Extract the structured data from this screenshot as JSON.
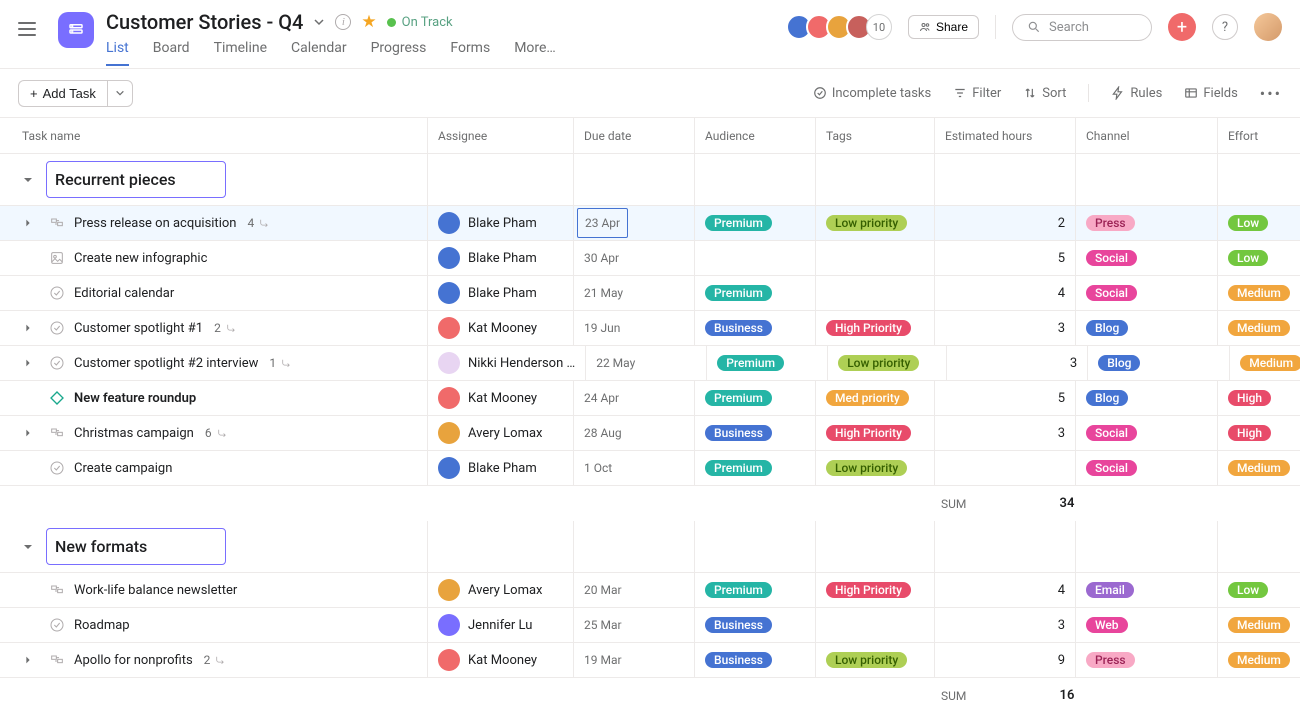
{
  "header": {
    "title": "Customer Stories - Q4",
    "status": "On Track",
    "tabs": [
      "List",
      "Board",
      "Timeline",
      "Calendar",
      "Progress",
      "Forms",
      "More…"
    ],
    "active_tab": 0,
    "avatar_count": "10",
    "share": "Share",
    "search_placeholder": "Search",
    "avatars": [
      {
        "bg": "#4573d2"
      },
      {
        "bg": "#f06a6a"
      },
      {
        "bg": "#e8a33d"
      },
      {
        "bg": "#c7605c"
      }
    ]
  },
  "toolbar": {
    "add_task": "Add Task",
    "incomplete": "Incomplete tasks",
    "filter": "Filter",
    "sort": "Sort",
    "rules": "Rules",
    "fields": "Fields"
  },
  "columns": {
    "task": "Task name",
    "assignee": "Assignee",
    "due": "Due date",
    "audience": "Audience",
    "tags": "Tags",
    "est": "Estimated hours",
    "channel": "Channel",
    "effort": "Effort"
  },
  "sections": [
    {
      "name": "Recurrent pieces",
      "rows": [
        {
          "expand": true,
          "icon": "milestone",
          "name": "Press release on acquisition",
          "subs": 4,
          "sub_icon": true,
          "assignee": "Blake Pham",
          "avatar": "bp",
          "due": "23 Apr",
          "due_box": true,
          "audience": {
            "t": "Premium",
            "c": "#25b5a6"
          },
          "tags": {
            "t": "Low priority",
            "c": "#aecf55",
            "tc": "#355f00"
          },
          "est": 2,
          "channel": {
            "t": "Press",
            "c": "#f8a9c5",
            "tc": "#9b2255"
          },
          "effort": {
            "t": "Low",
            "c": "#73c73f"
          },
          "hl": true
        },
        {
          "expand": false,
          "icon": "picture",
          "name": "Create new infographic",
          "assignee": "Blake Pham",
          "avatar": "bp",
          "due": "30 Apr",
          "est": 5,
          "channel": {
            "t": "Social",
            "c": "#e8459c"
          },
          "effort": {
            "t": "Low",
            "c": "#73c73f"
          }
        },
        {
          "expand": false,
          "icon": "circle",
          "name": "Editorial calendar",
          "assignee": "Blake Pham",
          "avatar": "bp",
          "due": "21 May",
          "audience": {
            "t": "Premium",
            "c": "#25b5a6"
          },
          "est": 4,
          "channel": {
            "t": "Social",
            "c": "#e8459c"
          },
          "effort": {
            "t": "Medium",
            "c": "#f1a63e"
          }
        },
        {
          "expand": true,
          "icon": "circle",
          "name": "Customer spotlight #1",
          "subs": 2,
          "sub_icon": true,
          "assignee": "Kat Mooney",
          "avatar": "km",
          "due": "19 Jun",
          "audience": {
            "t": "Business",
            "c": "#4573d2"
          },
          "tags": {
            "t": "High Priority",
            "c": "#e84b6a"
          },
          "est": 3,
          "channel": {
            "t": "Blog",
            "c": "#4573d2"
          },
          "effort": {
            "t": "Medium",
            "c": "#f1a63e"
          }
        },
        {
          "expand": true,
          "icon": "circle",
          "name": "Customer spotlight #2 interview",
          "subs": 1,
          "sub_icon": true,
          "assignee": "Nikki Henderson …",
          "avatar": "nh",
          "due": "22 May",
          "audience": {
            "t": "Premium",
            "c": "#25b5a6"
          },
          "tags": {
            "t": "Low priority",
            "c": "#aecf55",
            "tc": "#355f00"
          },
          "est": 3,
          "channel": {
            "t": "Blog",
            "c": "#4573d2"
          },
          "effort": {
            "t": "Medium",
            "c": "#f1a63e"
          }
        },
        {
          "expand": false,
          "icon": "diamond",
          "name": "New feature roundup",
          "bold": true,
          "assignee": "Kat Mooney",
          "avatar": "km",
          "due": "24 Apr",
          "audience": {
            "t": "Premium",
            "c": "#25b5a6"
          },
          "tags": {
            "t": "Med priority",
            "c": "#f1a63e"
          },
          "est": 5,
          "channel": {
            "t": "Blog",
            "c": "#4573d2"
          },
          "effort": {
            "t": "High",
            "c": "#e84b6a"
          }
        },
        {
          "expand": true,
          "icon": "milestone",
          "name": "Christmas campaign",
          "subs": 6,
          "sub_icon": true,
          "assignee": "Avery Lomax",
          "avatar": "al",
          "due": "28 Aug",
          "audience": {
            "t": "Business",
            "c": "#4573d2"
          },
          "tags": {
            "t": "High Priority",
            "c": "#e84b6a"
          },
          "est": 3,
          "channel": {
            "t": "Social",
            "c": "#e8459c"
          },
          "effort": {
            "t": "High",
            "c": "#e84b6a"
          }
        },
        {
          "expand": false,
          "icon": "circle",
          "name": "Create campaign",
          "assignee": "Blake Pham",
          "avatar": "bp",
          "due": "1 Oct",
          "audience": {
            "t": "Premium",
            "c": "#25b5a6"
          },
          "tags": {
            "t": "Low priority",
            "c": "#aecf55",
            "tc": "#355f00"
          },
          "channel": {
            "t": "Social",
            "c": "#e8459c"
          },
          "effort": {
            "t": "Medium",
            "c": "#f1a63e"
          }
        }
      ],
      "sum_label": "SUM",
      "sum": 34
    },
    {
      "name": "New formats",
      "rows": [
        {
          "expand": false,
          "icon": "milestone",
          "name": "Work-life balance newsletter",
          "assignee": "Avery Lomax",
          "avatar": "al",
          "due": "20 Mar",
          "audience": {
            "t": "Premium",
            "c": "#25b5a6"
          },
          "tags": {
            "t": "High Priority",
            "c": "#e84b6a"
          },
          "est": 4,
          "channel": {
            "t": "Email",
            "c": "#9b69d0"
          },
          "effort": {
            "t": "Low",
            "c": "#73c73f"
          }
        },
        {
          "expand": false,
          "icon": "circle",
          "name": "Roadmap",
          "assignee": "Jennifer Lu",
          "avatar": "jl",
          "due": "25 Mar",
          "audience": {
            "t": "Business",
            "c": "#4573d2"
          },
          "est": 3,
          "channel": {
            "t": "Web",
            "c": "#e8459c"
          },
          "effort": {
            "t": "Medium",
            "c": "#f1a63e"
          }
        },
        {
          "expand": true,
          "icon": "milestone",
          "name": "Apollo for nonprofits",
          "subs": 2,
          "sub_icon": true,
          "assignee": "Kat Mooney",
          "avatar": "km",
          "due": "19 Mar",
          "audience": {
            "t": "Business",
            "c": "#4573d2"
          },
          "tags": {
            "t": "Low priority",
            "c": "#aecf55",
            "tc": "#355f00"
          },
          "est": 9,
          "channel": {
            "t": "Press",
            "c": "#f8a9c5",
            "tc": "#9b2255"
          },
          "effort": {
            "t": "Medium",
            "c": "#f1a63e"
          }
        }
      ],
      "sum_label": "SUM",
      "sum": 16
    }
  ],
  "people": {
    "bp": {
      "bg": "#4573d2"
    },
    "km": {
      "bg": "#f06a6a"
    },
    "nh": {
      "bg": "#e8d5f2"
    },
    "al": {
      "bg": "#e8a33d"
    },
    "jl": {
      "bg": "#796eff"
    }
  }
}
